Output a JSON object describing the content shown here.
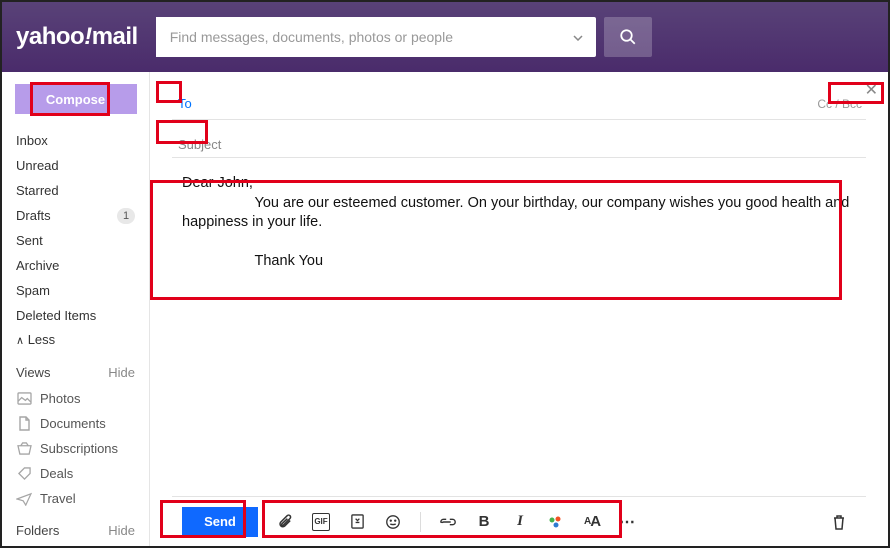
{
  "header": {
    "logo_before": "yahoo",
    "logo_after": "mail",
    "search_placeholder": "Find messages, documents, photos or people"
  },
  "sidebar": {
    "compose_label": "Compose",
    "folders": [
      {
        "label": "Inbox"
      },
      {
        "label": "Unread"
      },
      {
        "label": "Starred"
      },
      {
        "label": "Drafts",
        "badge": "1"
      },
      {
        "label": "Sent"
      },
      {
        "label": "Archive"
      },
      {
        "label": "Spam"
      },
      {
        "label": "Deleted Items"
      }
    ],
    "less_label": "Less",
    "views_label": "Views",
    "hide_label": "Hide",
    "views": [
      {
        "label": "Photos"
      },
      {
        "label": "Documents"
      },
      {
        "label": "Subscriptions"
      },
      {
        "label": "Deals"
      },
      {
        "label": "Travel"
      }
    ],
    "folders_label": "Folders"
  },
  "compose": {
    "to_label": "To",
    "ccbcc_label": "Cc / Bcc",
    "subject_label": "Subject",
    "body_line1": "Dear John,",
    "body_line2": "                  You are our esteemed customer. On your birthday, our company wishes you good health and happiness in your life.",
    "body_line3": "                  Thank You",
    "send_label": "Send"
  }
}
